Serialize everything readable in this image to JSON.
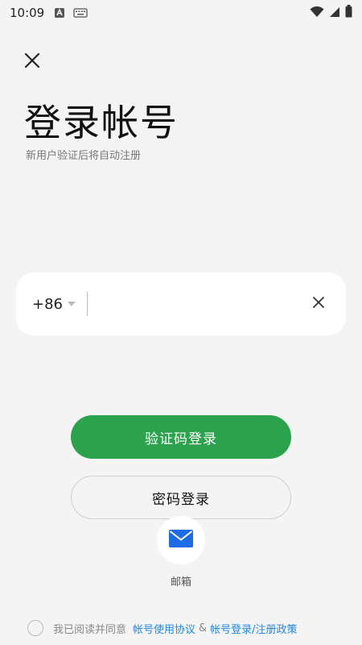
{
  "status_bar": {
    "time": "10:09",
    "icons_left": [
      "app-a-icon",
      "keyboard-icon"
    ],
    "icons_right": [
      "wifi-icon",
      "signal-icon",
      "battery-icon"
    ]
  },
  "header": {
    "title": "登录帐号",
    "subtitle": "新用户验证后将自动注册"
  },
  "phone_form": {
    "country_code": "+86",
    "phone_value": "",
    "phone_placeholder": ""
  },
  "actions": {
    "sms_login_label": "验证码登录",
    "password_login_label": "密码登录",
    "email_label": "邮箱"
  },
  "agreement": {
    "prefix": "我已阅读并同意",
    "link1": "帐号使用协议",
    "amp": "&",
    "link2": "帐号登录/注册政策"
  },
  "colors": {
    "primary_green": "#2ba24c",
    "link_blue": "#1e88e5",
    "email_icon_blue": "#1e6be6",
    "background": "#f4f4f4"
  }
}
